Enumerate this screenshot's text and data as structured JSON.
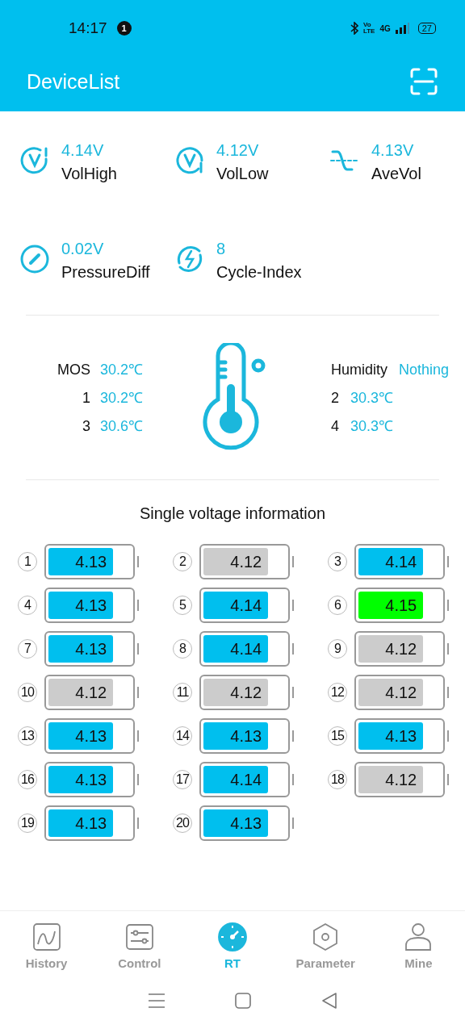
{
  "status_bar": {
    "time": "14:17",
    "notification_count": "1",
    "network": "4G",
    "volte_top": "Vo",
    "volte_bottom": "LTE",
    "battery": "27"
  },
  "header": {
    "title": "DeviceList"
  },
  "stats": [
    {
      "kind": "vol-high",
      "value": "4.14V",
      "label": "VolHigh"
    },
    {
      "kind": "vol-low",
      "value": "4.12V",
      "label": "VolLow"
    },
    {
      "kind": "ave-vol",
      "value": "4.13V",
      "label": "AveVol"
    },
    {
      "kind": "pressure",
      "value": "0.02V",
      "label": "PressureDiff"
    },
    {
      "kind": "cycle",
      "value": "8",
      "label": "Cycle-Index"
    }
  ],
  "temperatures": {
    "left": [
      {
        "label": "MOS",
        "value": "30.2℃"
      },
      {
        "label": "1",
        "value": "30.2℃"
      },
      {
        "label": "3",
        "value": "30.6℃"
      }
    ],
    "right": [
      {
        "label": "Humidity",
        "value": "Nothing"
      },
      {
        "label": "2",
        "value": "30.3℃"
      },
      {
        "label": "4",
        "value": "30.3℃"
      }
    ]
  },
  "cells_title": "Single voltage information",
  "cells": [
    {
      "index": "1",
      "value": "4.13",
      "color": "#00bfee",
      "level": 0.78
    },
    {
      "index": "2",
      "value": "4.12",
      "color": "#cccccc",
      "level": 0.78
    },
    {
      "index": "3",
      "value": "4.14",
      "color": "#00bfee",
      "level": 0.78
    },
    {
      "index": "4",
      "value": "4.13",
      "color": "#00bfee",
      "level": 0.78
    },
    {
      "index": "5",
      "value": "4.14",
      "color": "#00bfee",
      "level": 0.78
    },
    {
      "index": "6",
      "value": "4.15",
      "color": "#00ff00",
      "level": 0.78
    },
    {
      "index": "7",
      "value": "4.13",
      "color": "#00bfee",
      "level": 0.78
    },
    {
      "index": "8",
      "value": "4.14",
      "color": "#00bfee",
      "level": 0.78
    },
    {
      "index": "9",
      "value": "4.12",
      "color": "#cccccc",
      "level": 0.78
    },
    {
      "index": "10",
      "value": "4.12",
      "color": "#cccccc",
      "level": 0.78
    },
    {
      "index": "11",
      "value": "4.12",
      "color": "#cccccc",
      "level": 0.78
    },
    {
      "index": "12",
      "value": "4.12",
      "color": "#cccccc",
      "level": 0.78
    },
    {
      "index": "13",
      "value": "4.13",
      "color": "#00bfee",
      "level": 0.78
    },
    {
      "index": "14",
      "value": "4.13",
      "color": "#00bfee",
      "level": 0.78
    },
    {
      "index": "15",
      "value": "4.13",
      "color": "#00bfee",
      "level": 0.78
    },
    {
      "index": "16",
      "value": "4.13",
      "color": "#00bfee",
      "level": 0.78
    },
    {
      "index": "17",
      "value": "4.14",
      "color": "#00bfee",
      "level": 0.78
    },
    {
      "index": "18",
      "value": "4.12",
      "color": "#cccccc",
      "level": 0.78
    },
    {
      "index": "19",
      "value": "4.13",
      "color": "#00bfee",
      "level": 0.78
    },
    {
      "index": "20",
      "value": "4.13",
      "color": "#00bfee",
      "level": 0.78
    }
  ],
  "tabs": [
    {
      "kind": "history",
      "label": "History",
      "selected": false
    },
    {
      "kind": "control",
      "label": "Control",
      "selected": false
    },
    {
      "kind": "rt",
      "label": "RT",
      "selected": true
    },
    {
      "kind": "parameter",
      "label": "Parameter",
      "selected": false
    },
    {
      "kind": "mine",
      "label": "Mine",
      "selected": false
    }
  ]
}
